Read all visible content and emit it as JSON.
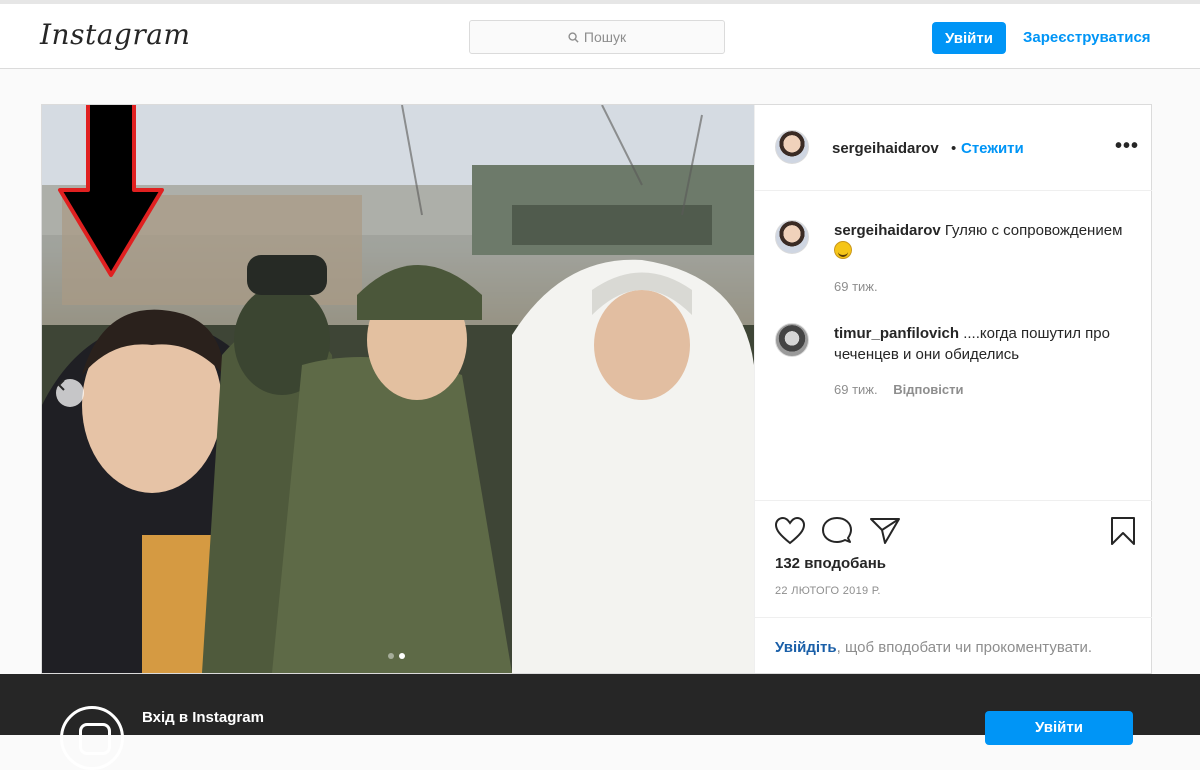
{
  "header": {
    "logo_text": "Instagram",
    "search_placeholder": "Пошук",
    "login_label": "Увійти",
    "register_label": "Зареєструватися"
  },
  "post": {
    "author": "sergeihaidarov",
    "separator": "•",
    "follow_label": "Стежити",
    "more_label": "•••",
    "carousel": {
      "slides": 2,
      "active_slide": 2
    },
    "comments": [
      {
        "user": "sergeihaidarov",
        "text": "Гуляю с сопровождением",
        "emoji": "smiling-face-sweat",
        "time": "69 тиж.",
        "reply_label": ""
      },
      {
        "user": "timur_panfilovich",
        "text": "....когда пошутил про чеченцев и они обиделись",
        "time": "69 тиж.",
        "reply_label": "Відповісти"
      }
    ],
    "likes": "132 вподобань",
    "date": "22 ЛЮТОГО 2019 Р.",
    "login_prompt": {
      "link": "Увійдіть",
      "text": ", щоб вподобати чи прокоментувати."
    },
    "icons": [
      "heart-icon",
      "comment-icon",
      "share-icon",
      "bookmark-icon"
    ]
  },
  "footer": {
    "title": "Вхід в Instagram",
    "login_label": "Увійти"
  },
  "colors": {
    "accent": "#0095f6",
    "text": "#262626",
    "muted": "#8e8e8e",
    "footer_bg": "#262626",
    "annotation_arrow": "#e02020"
  }
}
